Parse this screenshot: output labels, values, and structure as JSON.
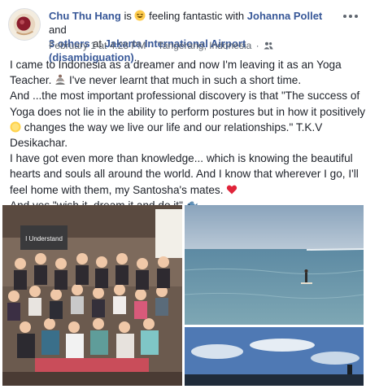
{
  "post": {
    "author": "Chu Thu Hang",
    "is_text": "is",
    "feeling_text": "feeling fantastic with",
    "tagged_person": "Johanna Pollet",
    "and_text": "and",
    "others_text": "3 others",
    "at_text": "at",
    "location": "Jakarta International Airport (disambiguation)",
    "period": ".",
    "timestamp": "February 1 at 4:28 PM",
    "meta_dot": "·",
    "place": "Tangerang, Indonesia",
    "more_icon": "more-horizontal-icon",
    "audience_icon": "friends-audience-icon"
  },
  "body": {
    "line1": "I came to Indonesia as a dreamer and now I'm leaving it as an Yoga",
    "line2a": "Teacher.",
    "line2b": "I've never learnt that much in such a short time.",
    "line3": "And ...the most important professional discovery is that \"The success of",
    "line4": "Yoga does not lie in the ability to perform postures but in how it positively",
    "line5b": "changes the way we live our life and our relationships.\" T.K.V",
    "line6": "Desikachar.",
    "line7": "I have got even more than knowledge... which is knowing the beautiful",
    "line8": "hearts and souls all around the world. And I know that wherever I go, I'll",
    "line9a": "feel home with them, my Santosha's mates.",
    "line10a": "And yes \"wish it, dream it and do it\"",
    "emojis": [
      "meditation-emoji",
      "sun-emoji",
      "heart-emoji",
      "fish-emoji"
    ]
  },
  "photos": {
    "main_sign_text": "I Understand",
    "items": [
      "yoga-group-photo",
      "paddleboard-sea-photo",
      "beach-sky-photo"
    ]
  },
  "colors": {
    "link": "#385898",
    "text": "#1d2129",
    "meta": "#606770",
    "heart": "#e0243a"
  }
}
